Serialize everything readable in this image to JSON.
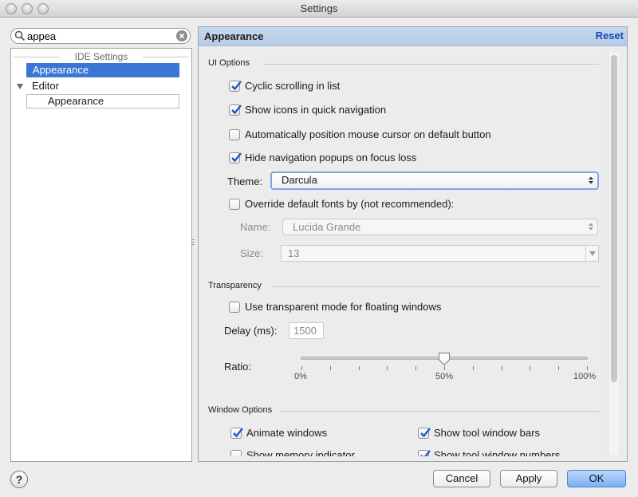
{
  "window": {
    "title": "Settings"
  },
  "search": {
    "value": "appea"
  },
  "tree": {
    "group_header": "IDE Settings",
    "items": [
      {
        "label": "Appearance"
      },
      {
        "label": "Editor"
      },
      {
        "label": "Appearance"
      }
    ]
  },
  "panel": {
    "title": "Appearance",
    "reset_label": "Reset",
    "ui_options": {
      "header": "UI Options",
      "cyclic_scrolling": {
        "label": "Cyclic scrolling in list",
        "checked": true
      },
      "show_icons": {
        "label": "Show icons in quick navigation",
        "checked": true
      },
      "auto_position": {
        "label": "Automatically position mouse cursor on default button",
        "checked": false
      },
      "hide_popups": {
        "label": "Hide navigation popups on focus loss",
        "checked": true
      },
      "theme_label": "Theme:",
      "theme_value": "Darcula",
      "override_fonts": {
        "label": "Override default fonts by (not recommended):",
        "checked": false
      },
      "name_label": "Name:",
      "name_value": "Lucida Grande",
      "size_label": "Size:",
      "size_value": "13"
    },
    "transparency": {
      "header": "Transparency",
      "transparent_mode": {
        "label": "Use transparent mode for floating windows",
        "checked": false
      },
      "delay_label": "Delay (ms):",
      "delay_value": "1500",
      "ratio_label": "Ratio:",
      "ratio_value_percent": 50,
      "tick_labels": [
        "0%",
        "50%",
        "100%"
      ]
    },
    "window_options": {
      "header": "Window Options",
      "animate_windows": {
        "label": "Animate windows",
        "checked": true
      },
      "show_tool_window_bars": {
        "label": "Show tool window bars",
        "checked": true
      },
      "show_memory_indicator": {
        "label": "Show memory indicator",
        "checked": false
      },
      "show_tool_window_numbers": {
        "label": "Show tool window numbers",
        "checked": true
      }
    }
  },
  "footer": {
    "help_label": "?",
    "cancel_label": "Cancel",
    "apply_label": "Apply",
    "ok_label": "OK"
  },
  "colors": {
    "selection": "#3c76d5",
    "header_blue": "#c6d9ef",
    "reset_link": "#1746b3",
    "ok_button": "#7ab0f4"
  }
}
